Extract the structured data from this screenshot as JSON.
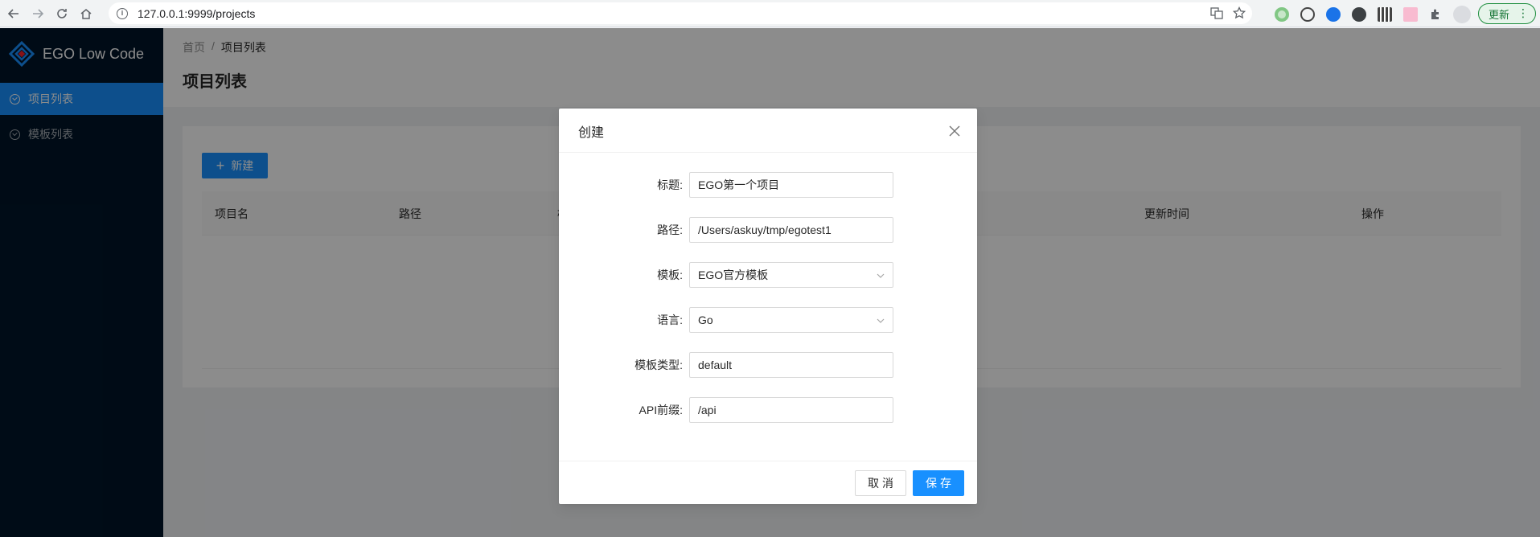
{
  "browser": {
    "url": "127.0.0.1:9999/projects",
    "update_label": "更新"
  },
  "sidebar": {
    "app_name": "EGO Low Code",
    "items": [
      {
        "label": "项目列表",
        "active": true
      },
      {
        "label": "模板列表",
        "active": false
      }
    ]
  },
  "header": {
    "breadcrumb": [
      "首页",
      "/",
      "项目列表"
    ],
    "title": "项目列表"
  },
  "content": {
    "new_button": "新建",
    "columns": [
      "项目名",
      "路径",
      "模",
      "更新时间",
      "操作"
    ]
  },
  "modal": {
    "title": "创建",
    "fields": [
      {
        "label": "标题:",
        "value": "EGO第一个项目",
        "type": "input"
      },
      {
        "label": "路径:",
        "value": "/Users/askuy/tmp/egotest1",
        "type": "input"
      },
      {
        "label": "模板:",
        "value": "EGO官方模板",
        "type": "select"
      },
      {
        "label": "语言:",
        "value": "Go",
        "type": "select"
      },
      {
        "label": "模板类型:",
        "value": "default",
        "type": "input"
      },
      {
        "label": "API前缀:",
        "value": "/api",
        "type": "input"
      }
    ],
    "cancel_label": "取消",
    "save_label": "保存"
  },
  "colors": {
    "primary": "#1890ff",
    "sidebar_bg": "#001529",
    "mask": "rgba(0,0,0,0.45)"
  }
}
